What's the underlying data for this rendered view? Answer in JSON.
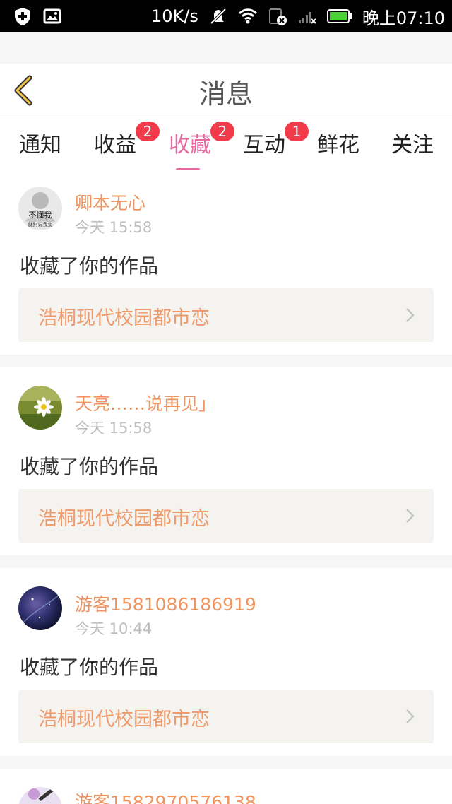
{
  "status_bar": {
    "speed": "10K/s",
    "time": "晚上07:10",
    "icons": [
      "shield-plus-icon",
      "image-icon",
      "mute-icon",
      "wifi-icon",
      "data-off-icon",
      "signal-icon",
      "battery-icon"
    ]
  },
  "header": {
    "title": "消息",
    "back_icon": "chevron-left-icon"
  },
  "tabs": [
    {
      "label": "通知"
    },
    {
      "label": "收益",
      "badge": "2"
    },
    {
      "label": "收藏",
      "badge": "2",
      "active": true
    },
    {
      "label": "互动",
      "badge": "1"
    },
    {
      "label": "鲜花"
    },
    {
      "label": "关注"
    }
  ],
  "cards": [
    {
      "name": "卿本无心",
      "time": "今天 15:58",
      "action": "收藏了你的作品",
      "work": "浩桐现代校园都市恋",
      "avatar_text": "不懂我",
      "avatar_sub": "就别说我变"
    },
    {
      "name": "天亮……说再见」",
      "time": "今天 15:58",
      "action": "收藏了你的作品",
      "work": "浩桐现代校园都市恋"
    },
    {
      "name": "游客1581086186919",
      "time": "今天 10:44",
      "action": "收藏了你的作品",
      "work": "浩桐现代校园都市恋"
    },
    {
      "name": "游客1582970576138"
    }
  ],
  "colors": {
    "accent": "#e86aa3",
    "name": "#f0945f",
    "badge": "#f23b4a",
    "work_title": "#ee9a6a"
  }
}
